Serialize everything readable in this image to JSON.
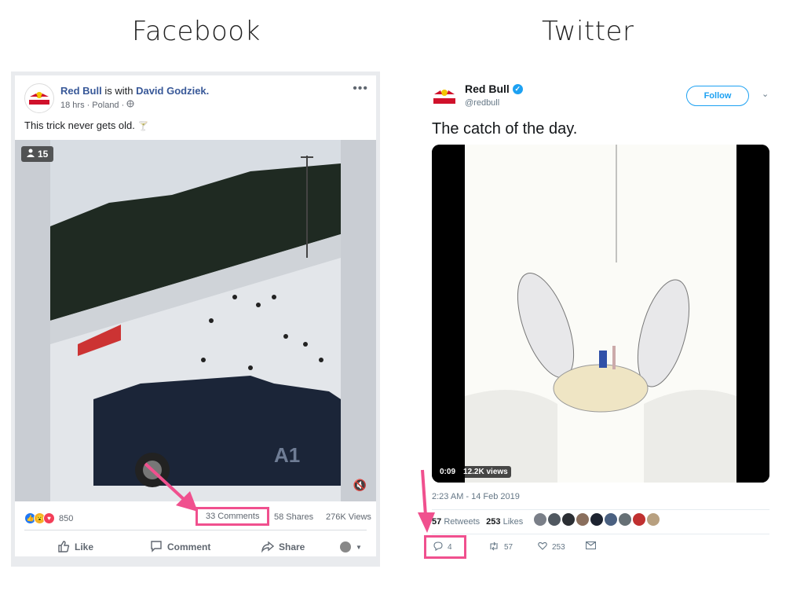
{
  "headings": {
    "facebook": "Facebook",
    "twitter": "Twitter"
  },
  "facebook": {
    "author_name": "Red Bull",
    "author_with": " is with ",
    "tagged_name": "David Godziek.",
    "meta_time": "18 hrs",
    "meta_location": "· Poland ·",
    "post_text": "This trick never gets old.",
    "viewer_count": "15",
    "reaction_count": "850",
    "comments": "33 Comments",
    "shares": "58 Shares",
    "views": "276K Views",
    "actions": {
      "like": "Like",
      "comment": "Comment",
      "share": "Share"
    },
    "video_car_text": "A1",
    "colors": {
      "link": "#385898",
      "highlight": "#f0508e"
    }
  },
  "twitter": {
    "name": "Red Bull",
    "handle": "@redbull",
    "follow_label": "Follow",
    "tweet_text": "The catch of the day.",
    "video_time": "0:09",
    "video_views": "12.2K views",
    "timestamp": "2:23 AM - 14 Feb 2019",
    "retweets_count": "57",
    "retweets_label": "Retweets",
    "likes_count": "253",
    "likes_label": "Likes",
    "actions": {
      "reply": "4",
      "retweet": "57",
      "like": "253"
    },
    "colors": {
      "accent": "#1da1f2",
      "highlight": "#f0508e"
    }
  }
}
